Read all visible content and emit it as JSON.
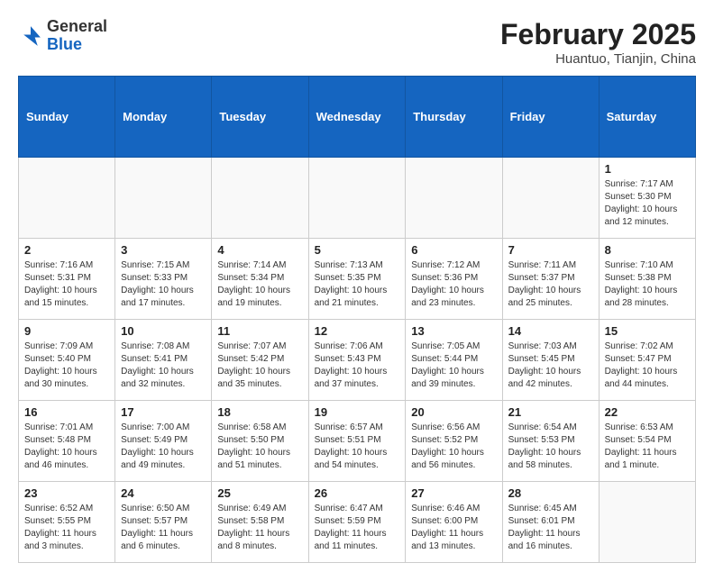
{
  "header": {
    "logo_general": "General",
    "logo_blue": "Blue",
    "month_title": "February 2025",
    "location": "Huantuo, Tianjin, China"
  },
  "days_of_week": [
    "Sunday",
    "Monday",
    "Tuesday",
    "Wednesday",
    "Thursday",
    "Friday",
    "Saturday"
  ],
  "weeks": [
    [
      {
        "day": "",
        "info": ""
      },
      {
        "day": "",
        "info": ""
      },
      {
        "day": "",
        "info": ""
      },
      {
        "day": "",
        "info": ""
      },
      {
        "day": "",
        "info": ""
      },
      {
        "day": "",
        "info": ""
      },
      {
        "day": "1",
        "info": "Sunrise: 7:17 AM\nSunset: 5:30 PM\nDaylight: 10 hours\nand 12 minutes."
      }
    ],
    [
      {
        "day": "2",
        "info": "Sunrise: 7:16 AM\nSunset: 5:31 PM\nDaylight: 10 hours\nand 15 minutes."
      },
      {
        "day": "3",
        "info": "Sunrise: 7:15 AM\nSunset: 5:33 PM\nDaylight: 10 hours\nand 17 minutes."
      },
      {
        "day": "4",
        "info": "Sunrise: 7:14 AM\nSunset: 5:34 PM\nDaylight: 10 hours\nand 19 minutes."
      },
      {
        "day": "5",
        "info": "Sunrise: 7:13 AM\nSunset: 5:35 PM\nDaylight: 10 hours\nand 21 minutes."
      },
      {
        "day": "6",
        "info": "Sunrise: 7:12 AM\nSunset: 5:36 PM\nDaylight: 10 hours\nand 23 minutes."
      },
      {
        "day": "7",
        "info": "Sunrise: 7:11 AM\nSunset: 5:37 PM\nDaylight: 10 hours\nand 25 minutes."
      },
      {
        "day": "8",
        "info": "Sunrise: 7:10 AM\nSunset: 5:38 PM\nDaylight: 10 hours\nand 28 minutes."
      }
    ],
    [
      {
        "day": "9",
        "info": "Sunrise: 7:09 AM\nSunset: 5:40 PM\nDaylight: 10 hours\nand 30 minutes."
      },
      {
        "day": "10",
        "info": "Sunrise: 7:08 AM\nSunset: 5:41 PM\nDaylight: 10 hours\nand 32 minutes."
      },
      {
        "day": "11",
        "info": "Sunrise: 7:07 AM\nSunset: 5:42 PM\nDaylight: 10 hours\nand 35 minutes."
      },
      {
        "day": "12",
        "info": "Sunrise: 7:06 AM\nSunset: 5:43 PM\nDaylight: 10 hours\nand 37 minutes."
      },
      {
        "day": "13",
        "info": "Sunrise: 7:05 AM\nSunset: 5:44 PM\nDaylight: 10 hours\nand 39 minutes."
      },
      {
        "day": "14",
        "info": "Sunrise: 7:03 AM\nSunset: 5:45 PM\nDaylight: 10 hours\nand 42 minutes."
      },
      {
        "day": "15",
        "info": "Sunrise: 7:02 AM\nSunset: 5:47 PM\nDaylight: 10 hours\nand 44 minutes."
      }
    ],
    [
      {
        "day": "16",
        "info": "Sunrise: 7:01 AM\nSunset: 5:48 PM\nDaylight: 10 hours\nand 46 minutes."
      },
      {
        "day": "17",
        "info": "Sunrise: 7:00 AM\nSunset: 5:49 PM\nDaylight: 10 hours\nand 49 minutes."
      },
      {
        "day": "18",
        "info": "Sunrise: 6:58 AM\nSunset: 5:50 PM\nDaylight: 10 hours\nand 51 minutes."
      },
      {
        "day": "19",
        "info": "Sunrise: 6:57 AM\nSunset: 5:51 PM\nDaylight: 10 hours\nand 54 minutes."
      },
      {
        "day": "20",
        "info": "Sunrise: 6:56 AM\nSunset: 5:52 PM\nDaylight: 10 hours\nand 56 minutes."
      },
      {
        "day": "21",
        "info": "Sunrise: 6:54 AM\nSunset: 5:53 PM\nDaylight: 10 hours\nand 58 minutes."
      },
      {
        "day": "22",
        "info": "Sunrise: 6:53 AM\nSunset: 5:54 PM\nDaylight: 11 hours\nand 1 minute."
      }
    ],
    [
      {
        "day": "23",
        "info": "Sunrise: 6:52 AM\nSunset: 5:55 PM\nDaylight: 11 hours\nand 3 minutes."
      },
      {
        "day": "24",
        "info": "Sunrise: 6:50 AM\nSunset: 5:57 PM\nDaylight: 11 hours\nand 6 minutes."
      },
      {
        "day": "25",
        "info": "Sunrise: 6:49 AM\nSunset: 5:58 PM\nDaylight: 11 hours\nand 8 minutes."
      },
      {
        "day": "26",
        "info": "Sunrise: 6:47 AM\nSunset: 5:59 PM\nDaylight: 11 hours\nand 11 minutes."
      },
      {
        "day": "27",
        "info": "Sunrise: 6:46 AM\nSunset: 6:00 PM\nDaylight: 11 hours\nand 13 minutes."
      },
      {
        "day": "28",
        "info": "Sunrise: 6:45 AM\nSunset: 6:01 PM\nDaylight: 11 hours\nand 16 minutes."
      },
      {
        "day": "",
        "info": ""
      }
    ]
  ]
}
